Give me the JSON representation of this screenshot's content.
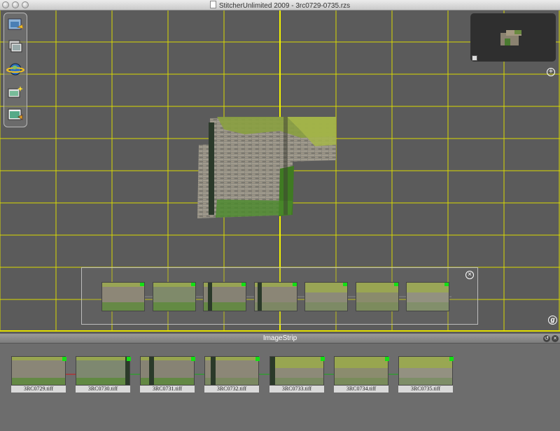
{
  "window": {
    "title": "StitcherUnlimited 2009 - 3rc0729-0735.rzs"
  },
  "toolbar": {
    "tools": [
      "open-project-icon",
      "image-stack-icon",
      "globe-render-icon",
      "stitch-wand-icon",
      "export-image-icon"
    ]
  },
  "canvas": {
    "grid_color": "#e6e600",
    "background": "#5b5b5b"
  },
  "navigator": {
    "zoom_label": "+"
  },
  "thumbnail_strip": {
    "count": 7,
    "close_label": "×"
  },
  "help_label": "g",
  "imagestrip": {
    "title": "ImageStrip",
    "files": [
      "3RC0729.tiff",
      "3RC0730.tiff",
      "3RC0731.tiff",
      "3RC0732.tiff",
      "3RC0733.tiff",
      "3RC0734.tiff",
      "3RC0735.tiff"
    ],
    "link_colors": [
      "#d01818",
      "#18b018",
      "#18b018",
      "#18b018",
      "#18b018",
      "#18b018"
    ]
  }
}
